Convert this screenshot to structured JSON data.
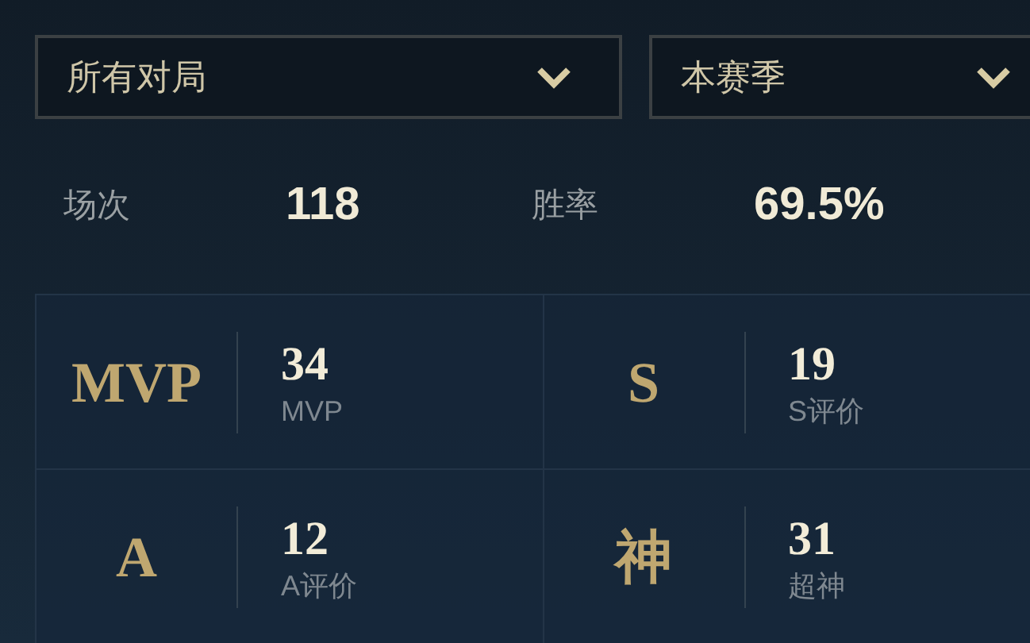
{
  "filters": [
    {
      "value": "所有对局"
    },
    {
      "value": "本赛季"
    }
  ],
  "summary": [
    {
      "label": "场次",
      "value": "118"
    },
    {
      "label": "胜率",
      "value": "69.5%"
    }
  ],
  "stats": [
    {
      "badge": "MVP",
      "count": "34",
      "label": "MVP"
    },
    {
      "badge": "S",
      "count": "19",
      "label": "S评价"
    },
    {
      "badge": "A",
      "count": "12",
      "label": "A评价"
    },
    {
      "badge": "神",
      "count": "31",
      "label": "超神"
    }
  ]
}
